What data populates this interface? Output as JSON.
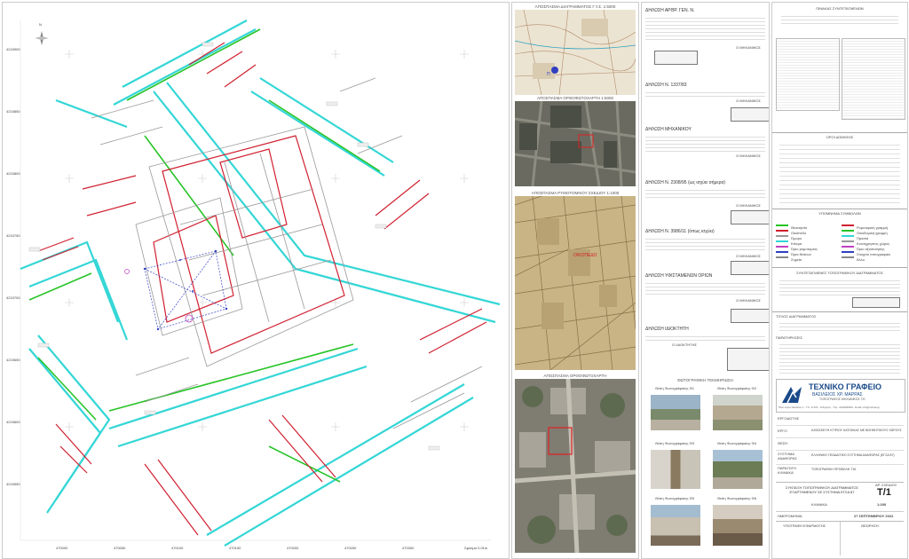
{
  "plan": {
    "north_label": "N",
    "bottom_ticks": [
      "470000",
      "470050",
      "470100",
      "470150",
      "470200",
      "470250",
      "470300",
      "470350"
    ],
    "left_ticks": [
      "4215900",
      "4215850",
      "4215800",
      "4215750",
      "4215700",
      "4215650",
      "4215600",
      "4215550",
      "4215500"
    ],
    "bottom_note": "Σφάλμα 0.01m"
  },
  "middle": {
    "map1_caption": "ΑΠΟΣΠΑΣΜΑ ΔΙΑΓΡΑΜΜΑΤΟΣ Γ.Υ.Σ. 1:5000",
    "map2_caption": "ΑΠΟΣΠΑΣΜΑ ΟΡΘΟΦΩΤΟΧΑΡΤΗ 1:5000",
    "map3_caption": "ΑΠΟΣΠΑΣΜΑ ΡΥΜΟΤΟΜΙΚΟΥ ΣΧΕΔΙΟΥ 1:1000",
    "map4_caption": "ΑΠΟΣΠΑΣΜΑ ΟΡΘΟΦΩΤΟΧΑΡΤΗ",
    "map3_label": "ΟΙΚΟΠΕΔΟ",
    "photos_caption": "ΦΩΤΟΓΡΑΦΙΚΗ ΤΕΚΜΗΡΙΩΣΗ",
    "photo_labels": [
      "Θέση Φωτογράφισης Φ1",
      "Θέση Φωτογράφισης Φ2",
      "Θέση Φωτογράφισης Φ3",
      "Θέση Φωτογράφισης Φ4",
      "Θέση Φωτογράφισης Φ5",
      "Θέση Φωτογράφισης Φ6"
    ]
  },
  "notes": [
    {
      "title": "ΔΗΛΩΣΗ ΑΡΘΡ. ΓΕΝ. Ν.",
      "sign": "Ο ΜΗΧΑΝΙΚΟΣ"
    },
    {
      "title": "ΔΗΛΩΣΗ Ν. 1337/83",
      "sign": "Ο ΜΗΧΑΝΙΚΟΣ"
    },
    {
      "title": "ΔΗΛΩΣΗ ΜΗΧΑΝΙΚΟΥ",
      "sign": "Ο ΜΗΧΑΝΙΚΟΣ"
    },
    {
      "title": "ΔΗΛΩΣΗ Ν. 2308/95 (ως ισχύει σήμερα)",
      "sign": "Ο ΜΗΧΑΝΙΚΟΣ"
    },
    {
      "title": "ΔΗΛΩΣΗ Ν. 3986/11 (όπως ισχύει)",
      "sign": "Ο ΜΗΧΑΝΙΚΟΣ"
    },
    {
      "title": "ΔΗΛΩΣΗ ΥΦΙΣΤΑΜΕΝΩΝ ΟΡΙΩΝ",
      "sign": "Ο ΜΗΧΑΝΙΚΟΣ"
    },
    {
      "title": "ΔΗΛΩΣΗ ΙΔΙΟΚΤΗΤΗ",
      "sign": "Ο ΙΔΙΟΚΤΗΤΗΣ"
    }
  ],
  "right": {
    "top_title": "ΠΙΝΑΚΑΣ ΣΥΝΤΕΤΑΓΜΕΝΩΝ",
    "area_title": "ΟΡΟΙ ΔΟΜΗΣΗΣ",
    "legend_title": "ΥΠΟΜΝΗΜΑ ΣΥΜΒΟΛΩΝ",
    "legend_items_left": [
      "Ιδιοκτησία",
      "Οικόπεδο",
      "Όμορο",
      "Κτίσμα",
      "Όριο ρυμοτομίας",
      "Όρια θέσεων",
      "Σημεία"
    ],
    "legend_items_right": [
      "Ρυμοτομική γραμμή",
      "Οικοδομική γραμμή",
      "Πρασιά",
      "Κοινόχρηστος χώρος",
      "Όριο αξιοποίησης",
      "Στοιχείο τοπογραφικό",
      "Άλλο"
    ],
    "coord_section_title": "ΣΥΝΤΕΤΑΓΜΕΝΕΣ ΤΟΠΟΓΡΑΦΙΚΟΥ ΔΙΑΓΡΑΜΜΑΤΟΣ",
    "study_title": "ΤΙΤΛΟΣ ΔΙΑΓΡΑΜΜΑΤΟΣ",
    "remarks_title": "ΠΑΡΑΤΗΡΗΣΕΙΣ",
    "firm_name": "ΤΕΧΝΙΚΟ ΓΡΑΦΕΙΟ",
    "firm_person": "ΒΑΣΙΛΕΙΟΣ ΧΡ. ΜΑΡΡΑΣ",
    "firm_role": "ΤΟΠΟΓΡΑΦΟΣ ΜΗΧΑΝΙΚΟΣ Τ.Ε.",
    "firm_address": "Πλατ.Αγίου Νικολάου 1 - Τ.Κ. 17122 - Ν.Σμύρνη - Τηλ.: 2109300000 - Email: info@marras.gr",
    "field_labels": [
      "ΕΡΓΟΔΟΤΗΣ",
      "ΕΡΓΟ",
      "ΘΕΣΗ",
      "ΣΥΣΤΗΜΑ ΑΝΑΦΟΡΑΣ",
      "ΠΑΡΑΓΩΓΗ ΚΛΙΜΑΚΑ"
    ],
    "field_values": [
      "",
      "ΚΑΤΑΣΚΕΥΗ ΚΤΙΡΙΟΥ ΚΑΤΟΙΚΙΑΣ ΜΕ ΒΟΗΘΗΤΙΚΟΥΣ ΧΩΡΟΥΣ",
      "",
      "ΕΛΛΗΝΙΚΟ ΓΕΩΔΑΙΤΙΚΟ ΣΥΣΤΗΜΑ ΑΝΑΦΟΡΑΣ (ΕΓΣΑ 87)",
      "ΤΟΠΟΓΡΑΦΙΚΗ ΠΡΟΒΟΛΗ Τ.Μ."
    ],
    "drawing_title": "ΣΥΝΤΑΞΗ ΤΟΠΟΓΡΑΦΙΚΟΥ ΔΙΑΓΡΑΜΜΑΤΟΣ ΕΞΑΡΤΗΜΕΝΟΥ ΣΕ ΣΥΣΤΗΜΑ ΕΓΣΑ 87",
    "sheet_label": "ΑΡ. ΣΧΕΔΙΟΥ",
    "sheet_no": "Τ/1",
    "scale_label": "ΚΛΙΜΑΚΑ",
    "scale_value": "1:200",
    "date_label": "ΗΜΕΡΟΜΗΝΙΑ",
    "date_value": "27 ΣΕΠΤΕΜΒΡΙΟΥ 2022",
    "sign_left": "ΥΠΟΓΡΑΦΗ ΕΦΑΡΜΟΓΗΣ",
    "sign_right": "ΘΕΩΡΗΣΗ"
  },
  "colors": {
    "cyan": "#34d6d6",
    "green": "#28c428",
    "red": "#d02030",
    "grey": "#999999",
    "accent": "#1a4a8a"
  }
}
